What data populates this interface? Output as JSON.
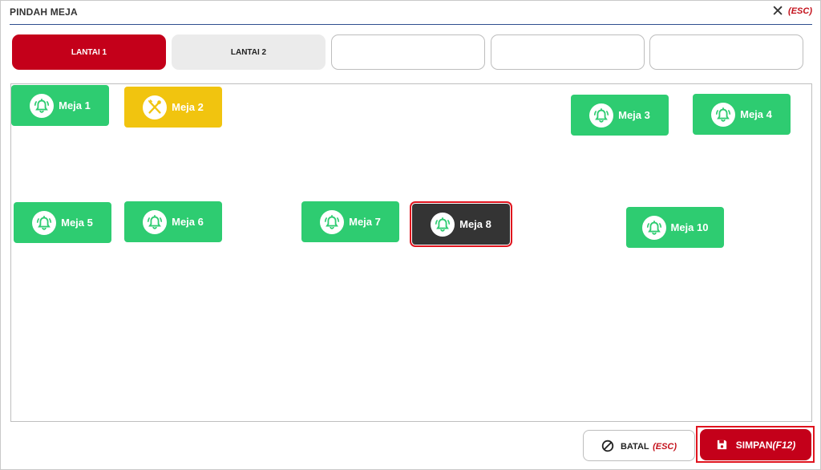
{
  "dialog": {
    "title": "PINDAH MEJA",
    "close_shortcut": "(ESC)"
  },
  "floors": [
    {
      "label": "LANTAI 1",
      "state": "active"
    },
    {
      "label": "LANTAI 2",
      "state": "inactive"
    },
    {
      "label": "",
      "state": "empty"
    },
    {
      "label": "",
      "state": "empty"
    },
    {
      "label": "",
      "state": "empty"
    }
  ],
  "tables": [
    {
      "label": "Meja 1",
      "status": "available",
      "icon": "bell-icon"
    },
    {
      "label": "Meja 2",
      "status": "occupied",
      "icon": "utensils-icon"
    },
    {
      "label": "Meja 3",
      "status": "available",
      "icon": "bell-icon"
    },
    {
      "label": "Meja 4",
      "status": "available",
      "icon": "bell-icon"
    },
    {
      "label": "Meja 5",
      "status": "available",
      "icon": "bell-icon"
    },
    {
      "label": "Meja 6",
      "status": "available",
      "icon": "bell-icon"
    },
    {
      "label": "Meja 7",
      "status": "available",
      "icon": "bell-icon"
    },
    {
      "label": "Meja 8",
      "status": "selected",
      "icon": "bell-icon"
    },
    {
      "label": "Meja 10",
      "status": "available",
      "icon": "bell-icon"
    }
  ],
  "footer": {
    "cancel_label": "BATAL",
    "cancel_shortcut": "(ESC)",
    "save_label": "SIMPAN",
    "save_shortcut": "(F12)"
  },
  "colors": {
    "accent_red": "#c4001a",
    "available_green": "#2ecc71",
    "occupied_yellow": "#f1c40f",
    "selected_dark": "#343434"
  }
}
